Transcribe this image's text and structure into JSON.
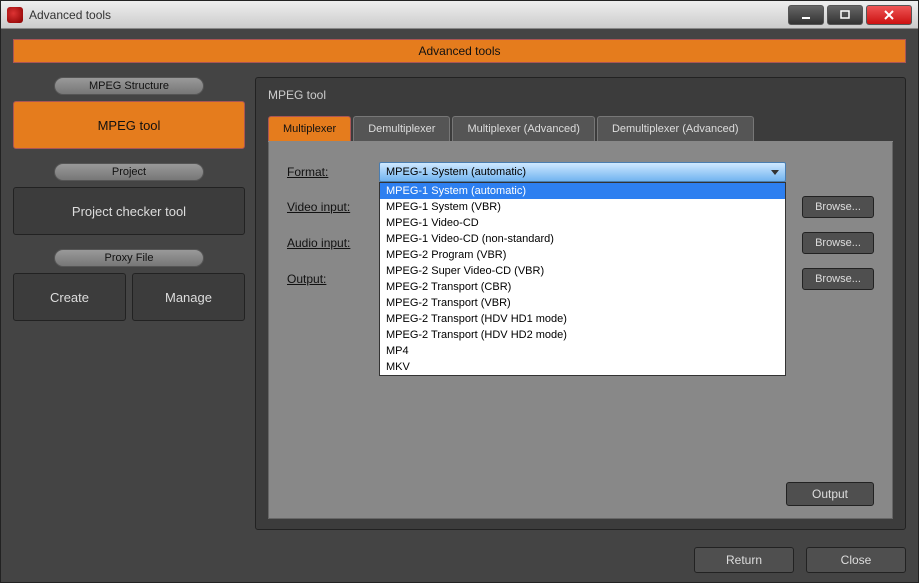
{
  "window": {
    "title": "Advanced tools"
  },
  "banner": {
    "title": "Advanced tools"
  },
  "sidebar": {
    "groups": [
      {
        "pill": "MPEG Structure",
        "buttons": [
          {
            "label": "MPEG tool",
            "active": true
          }
        ]
      },
      {
        "pill": "Project",
        "buttons": [
          {
            "label": "Project checker tool",
            "active": false
          }
        ]
      },
      {
        "pill": "Proxy File",
        "buttons": [
          {
            "label": "Create",
            "active": false
          },
          {
            "label": "Manage",
            "active": false
          }
        ]
      }
    ]
  },
  "main": {
    "title": "MPEG tool",
    "tabs": [
      {
        "label": "Multiplexer",
        "active": true
      },
      {
        "label": "Demultiplexer",
        "active": false
      },
      {
        "label": "Multiplexer (Advanced)",
        "active": false
      },
      {
        "label": "Demultiplexer (Advanced)",
        "active": false
      }
    ],
    "form": {
      "format_label": "Format:",
      "format_value": "MPEG-1 System (automatic)",
      "video_label": "Video input:",
      "audio_label": "Audio input:",
      "output_label": "Output:",
      "browse_label": "Browse...",
      "dropdown_options": [
        "MPEG-1 System (automatic)",
        "MPEG-1 System (VBR)",
        "MPEG-1 Video-CD",
        "MPEG-1 Video-CD (non-standard)",
        "MPEG-2 Program (VBR)",
        "MPEG-2 Super Video-CD (VBR)",
        "MPEG-2 Transport (CBR)",
        "MPEG-2 Transport (VBR)",
        "MPEG-2 Transport (HDV HD1 mode)",
        "MPEG-2 Transport (HDV HD2 mode)",
        "MP4",
        "MKV"
      ],
      "dropdown_selected_index": 0
    },
    "output_button": "Output"
  },
  "footer": {
    "return_label": "Return",
    "close_label": "Close"
  }
}
